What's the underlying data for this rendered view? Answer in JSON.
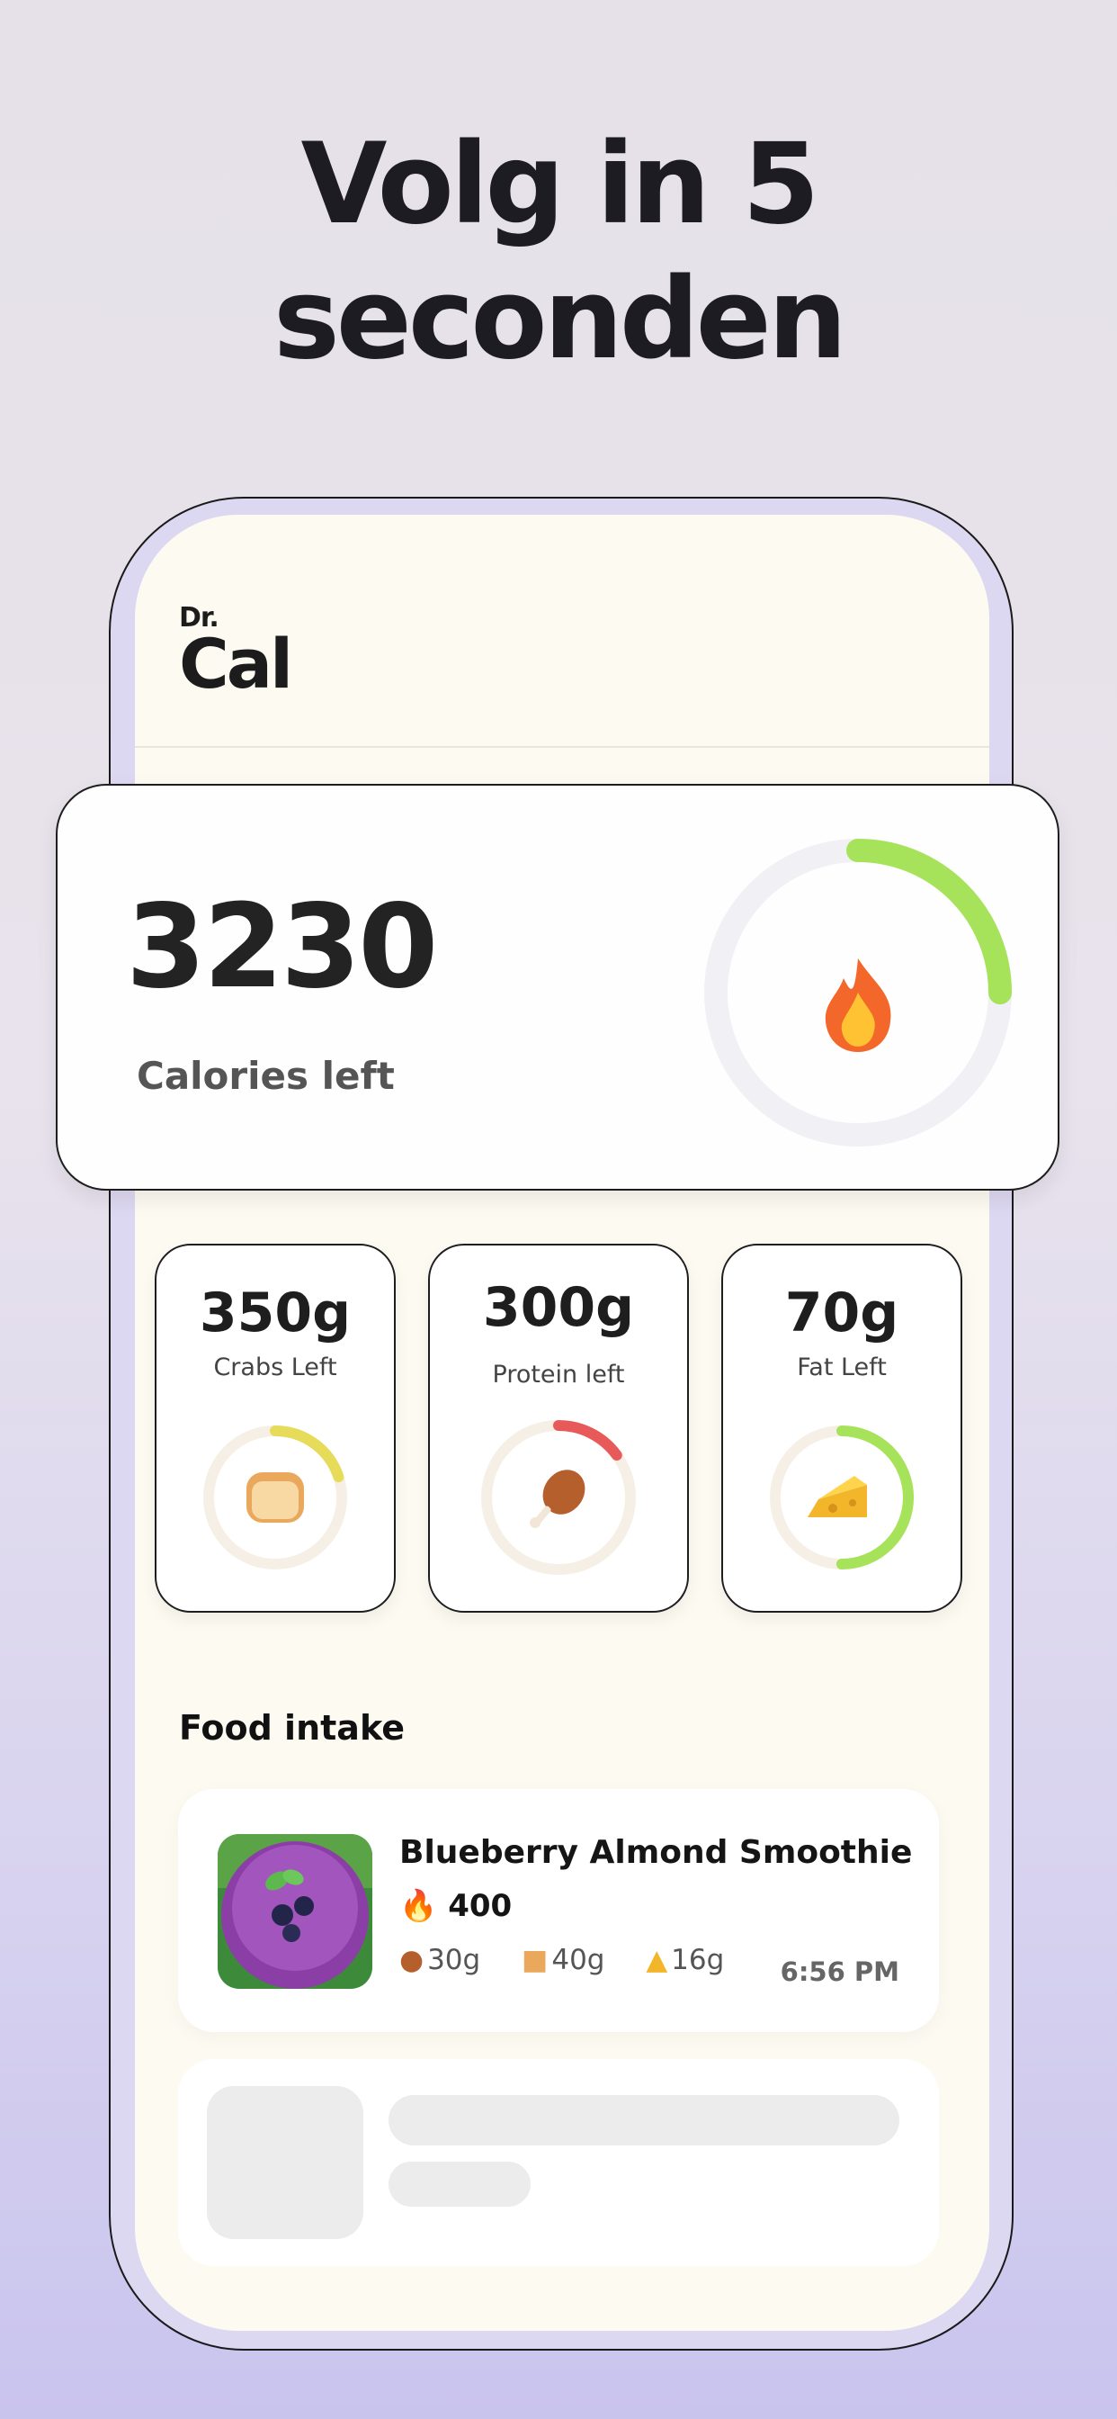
{
  "headline": {
    "line1": "Volg in 5",
    "line2": "seconden"
  },
  "app": {
    "logo_small": "Dr.",
    "logo_large": "Cal"
  },
  "calories": {
    "value": "3230",
    "label": "Calories left",
    "progress": 0.25,
    "accent": "#a6e35a"
  },
  "macros": [
    {
      "value": "350g",
      "label": "Crabs Left",
      "icon": "bread-icon",
      "progress": 0.2,
      "color": "#e6dc5a"
    },
    {
      "value": "300g",
      "label": "Protein left",
      "icon": "chicken-leg-icon",
      "progress": 0.15,
      "color": "#e85a5a"
    },
    {
      "value": "70g",
      "label": "Fat Left",
      "icon": "cheese-icon",
      "progress": 0.5,
      "color": "#a6e35a"
    }
  ],
  "food_section": {
    "title": "Food intake",
    "items": [
      {
        "name": "Blueberry Almond Smoothie",
        "calories": "400",
        "protein": "30g",
        "carbs": "40g",
        "fat": "16g",
        "time": "6:56 PM"
      }
    ]
  }
}
